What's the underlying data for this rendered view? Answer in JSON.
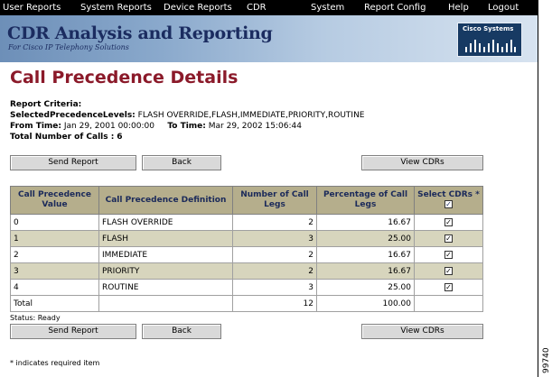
{
  "menu": [
    "User Reports",
    "System Reports",
    "Device Reports",
    "CDR",
    "System",
    "Report Config",
    "Help",
    "Logout"
  ],
  "banner": {
    "title": "CDR Analysis and Reporting",
    "subtitle": "For Cisco IP Telephony Solutions",
    "logo_text": "Cisco Systems"
  },
  "page_title": "Call Precedence Details",
  "criteria": {
    "heading": "Report Criteria:",
    "levels_label": "SelectedPrecedenceLevels:",
    "levels_value": "FLASH OVERRIDE,FLASH,IMMEDIATE,PRIORITY,ROUTINE",
    "from_label": "From Time:",
    "from_value": "Jan 29, 2001 00:00:00",
    "to_label": "To Time:",
    "to_value": "Mar 29, 2002 15:06:44",
    "total_label": "Total Number of Calls :",
    "total_value": "6"
  },
  "buttons": {
    "send_report": "Send Report",
    "back": "Back",
    "view_cdrs": "View CDRs"
  },
  "table": {
    "headers": [
      "Call Precedence Value",
      "Call Precedence Definition",
      "Number of Call Legs",
      "Percentage of Call Legs",
      "Select CDRs *"
    ],
    "rows": [
      {
        "value": "0",
        "definition": "FLASH OVERRIDE",
        "legs": "2",
        "percent": "16.67",
        "checked": true
      },
      {
        "value": "1",
        "definition": "FLASH",
        "legs": "3",
        "percent": "25.00",
        "checked": true
      },
      {
        "value": "2",
        "definition": "IMMEDIATE",
        "legs": "2",
        "percent": "16.67",
        "checked": true
      },
      {
        "value": "3",
        "definition": "PRIORITY",
        "legs": "2",
        "percent": "16.67",
        "checked": true
      },
      {
        "value": "4",
        "definition": "ROUTINE",
        "legs": "3",
        "percent": "25.00",
        "checked": true
      }
    ],
    "total": {
      "label": "Total",
      "legs": "12",
      "percent": "100.00"
    }
  },
  "status": "Status: Ready",
  "required_note": "* indicates required item",
  "figure_id": "99740",
  "colors": {
    "menubar": "#000000",
    "title": "#8b1a2a",
    "header_bg": "#b5ae8c",
    "row_alt": "#d7d5bd",
    "button": "#d9d9d9"
  }
}
